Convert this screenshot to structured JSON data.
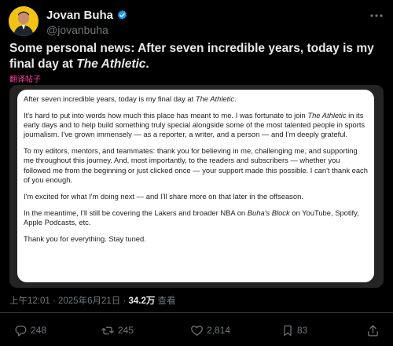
{
  "author": {
    "display_name": "Jovan Buha",
    "handle": "@jovanbuha",
    "verified": true,
    "verified_color": "#1d9bf0",
    "avatar_bg": "#f2c315"
  },
  "tweet": {
    "text_main": "Some personal news: After seven incredible years, today is my final day at ",
    "text_italic": "The Athletic",
    "text_end": ".",
    "translate_label": "翻译帖子",
    "translate_color": "#ff3fa0"
  },
  "attached_note": {
    "p1_a": "After seven incredible years, today is my final day at ",
    "p1_i": "The Athletic",
    "p1_b": ".",
    "p2_a": "It's hard to put into words how much this place has meant to me. I was fortunate to join ",
    "p2_i": "The Athletic",
    "p2_b": " in its early days and to help build something truly special alongside some of the most talented people in sports journalism. I've grown immensely — as a reporter, a writer, and a person — and I'm deeply grateful.",
    "p3": "To my editors, mentors, and teammates: thank you for believing in me, challenging me, and supporting me throughout this journey. And, most importantly, to the readers and subscribers — whether you followed me from the beginning or just clicked once — your support made this possible. I can't thank each of you enough.",
    "p4": "I'm excited for what I'm doing next — and I'll share more on that later in the offseason.",
    "p5_a": "In the meantime, I'll still be covering the Lakers and broader NBA on ",
    "p5_i": "Buha's Block",
    "p5_b": " on YouTube, Spotify, Apple Podcasts, etc.",
    "p6": "Thank you for everything. Stay tuned."
  },
  "meta": {
    "timestamp": "上午12:01 · 2025年6月21日 · ",
    "views_count": "34.2万",
    "views_label": " 查看"
  },
  "actions": {
    "replies": "248",
    "reposts": "245",
    "likes": "2,814",
    "bookmarks": "83"
  },
  "icons": {
    "more": "more-icon",
    "reply": "reply-icon",
    "repost": "repost-icon",
    "like": "like-icon",
    "bookmark": "bookmark-icon",
    "share": "share-icon",
    "verified": "verified-badge-icon"
  }
}
